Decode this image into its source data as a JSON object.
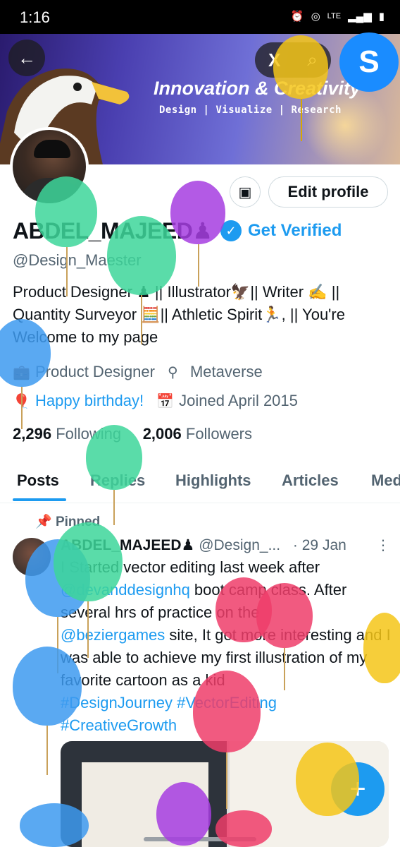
{
  "status_bar": {
    "time": "1:16",
    "network": "LTE"
  },
  "banner": {
    "title": "Innovation & Creativity",
    "subtitle": "Design | Visualize | Research"
  },
  "header_buttons": {
    "back_icon": "arrow-left-icon",
    "grok_icon": "x-logo-icon",
    "search_icon": "search-icon"
  },
  "profile": {
    "edit_label": "Edit profile",
    "name": "ABDEL_MAJEED♟",
    "get_verified": "Get Verified",
    "handle": "@Design_Maester",
    "bio": "Product Designer ♟ || Illustrator🦅|| Writer ✍️ || Quantity Surveyor 🧮|| Athletic Spirit🏃, || You're Welcome to my page",
    "profession": "Product Designer",
    "location": "Metaverse",
    "birthday": "Happy birthday!",
    "joined": "Joined April 2015",
    "following_count": "2,296",
    "following_label": "Following",
    "followers_count": "2,006",
    "followers_label": "Followers"
  },
  "tabs": [
    "Posts",
    "Replies",
    "Highlights",
    "Articles",
    "Media"
  ],
  "post": {
    "pinned_label": "Pinned",
    "author": "ABDEL_MAJEED♟",
    "handle": "@Design_...",
    "date": "· 29 Jan",
    "line1": "I Started vector editing last week after",
    "mention1": "@devanddesignhq",
    "line2": " boot camp class. After several hrs of practice on the",
    "mention2": "@beziergames",
    "line3": " site, It got more interesting and I was able to achieve my first illustration of my favorite cartoon as a kid",
    "tag1": "#DesignJourney",
    "tag2": "#VectorEditing",
    "tag3": "#CreativeGrowth"
  },
  "fab_label": "+",
  "colors": {
    "accent": "#1d9bf0",
    "text": "#0f1419",
    "muted": "#536471"
  }
}
